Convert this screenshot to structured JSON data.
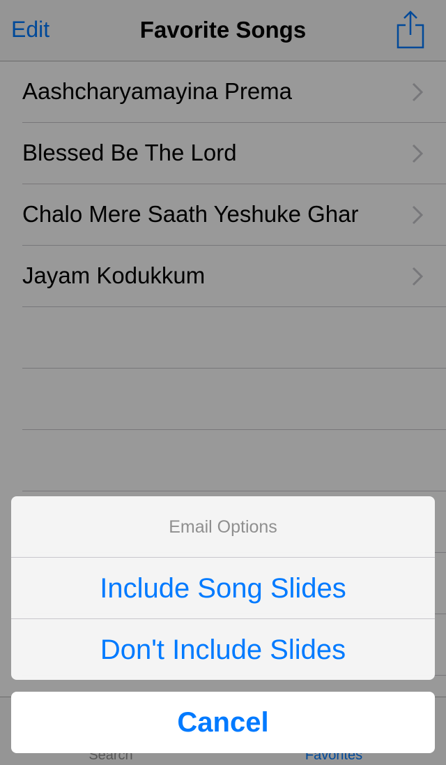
{
  "navbar": {
    "edit_label": "Edit",
    "title": "Favorite Songs",
    "share_icon": "share-icon"
  },
  "songs": [
    {
      "title": "Aashcharyamayina Prema"
    },
    {
      "title": "Blessed Be The Lord"
    },
    {
      "title": "Chalo Mere Saath Yeshuke Ghar"
    },
    {
      "title": "Jayam Kodukkum"
    }
  ],
  "tabbar": {
    "search_label": "Search",
    "favorites_label": "Favorites"
  },
  "action_sheet": {
    "title": "Email Options",
    "option_1": "Include Song Slides",
    "option_2": "Don't Include Slides",
    "cancel": "Cancel"
  },
  "colors": {
    "accent": "#007aff",
    "overlay": "rgba(0,0,0,0.4)"
  }
}
